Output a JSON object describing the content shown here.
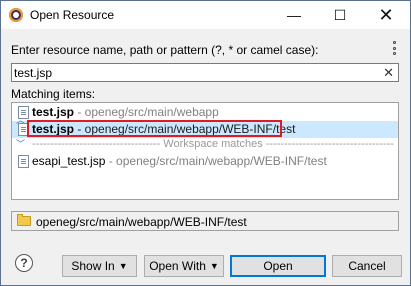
{
  "window": {
    "title": "Open Resource",
    "minimize_icon": "—",
    "maximize_icon": "☐",
    "close_icon": "✕"
  },
  "prompt_label": "Enter resource name, path or pattern (?, * or camel case):",
  "search": {
    "value": "test.jsp",
    "clear_icon": "✕"
  },
  "matching_label": "Matching items:",
  "results": [
    {
      "name": "test.jsp",
      "path": " - openeg/src/main/webapp",
      "selected": false
    },
    {
      "name": "test.jsp",
      "path": " - openeg/src/main/webapp/WEB-INF/test",
      "selected": true
    }
  ],
  "workspace_separator": "----------------------------------- Workspace matches -----------------------------------",
  "workspace_results": [
    {
      "name": "esapi_test.jsp",
      "path": " - openeg/src/main/webapp/WEB-INF/test"
    }
  ],
  "status_path": "openeg/src/main/webapp/WEB-INF/test",
  "buttons": {
    "help": "?",
    "show_in": "Show In",
    "open_with": "Open With",
    "open": "Open",
    "cancel": "Cancel",
    "caret": "▼"
  },
  "colors": {
    "selection": "#cce8ff",
    "highlight_border": "#e01b24",
    "default_button_border": "#0078d7"
  }
}
